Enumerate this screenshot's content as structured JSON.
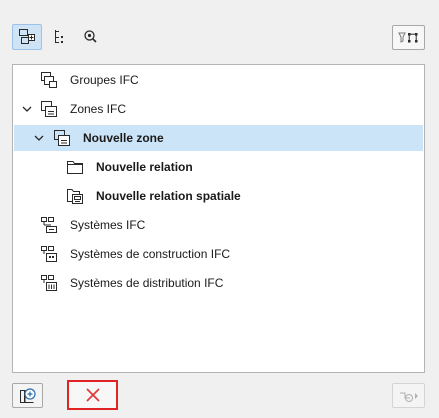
{
  "tree": {
    "items": [
      {
        "label": "Groupes IFC",
        "bold": false,
        "icon": "ifc-group-icon",
        "expanded": null,
        "selected": false
      },
      {
        "label": "Zones IFC",
        "bold": false,
        "icon": "ifc-zone-icon",
        "expanded": true,
        "selected": false
      },
      {
        "label": "Nouvelle zone",
        "bold": true,
        "icon": "ifc-zone-icon",
        "expanded": true,
        "selected": true
      },
      {
        "label": "Nouvelle relation",
        "bold": true,
        "icon": "folder-icon",
        "expanded": null,
        "selected": false
      },
      {
        "label": "Nouvelle relation spatiale",
        "bold": true,
        "icon": "spatial-relation-icon",
        "expanded": null,
        "selected": false
      },
      {
        "label": "Systèmes IFC",
        "bold": false,
        "icon": "ifc-system-icon",
        "expanded": null,
        "selected": false
      },
      {
        "label": "Systèmes de construction IFC",
        "bold": false,
        "icon": "ifc-building-system-icon",
        "expanded": null,
        "selected": false
      },
      {
        "label": "Systèmes de distribution IFC",
        "bold": false,
        "icon": "ifc-distribution-system-icon",
        "expanded": null,
        "selected": false
      }
    ]
  },
  "colors": {
    "selection": "#cce4f7",
    "delete_highlight": "#e02424",
    "delete_icon": "#e03a3a"
  }
}
